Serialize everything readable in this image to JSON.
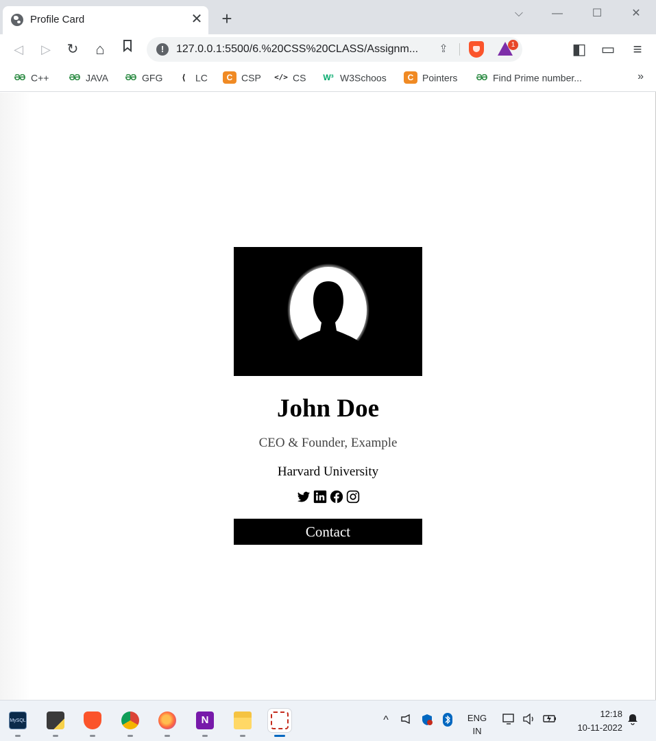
{
  "browser": {
    "tab": {
      "title": "Profile Card",
      "close_glyph": "✕"
    },
    "new_tab_glyph": "+",
    "window_controls": {
      "tabsearch": "⌵",
      "minimize": "—",
      "maximize": "☐",
      "close": "✕"
    },
    "toolbar": {
      "back_icon": "◁",
      "forward_icon": "▷",
      "reload_icon": "↻",
      "home_icon": "⌂",
      "bookmark_icon": "🔖",
      "url": "127.0.0.1:5500/6.%20CSS%20CLASS/Assignm...",
      "info_icon": "!",
      "share_icon": "⇪",
      "rewards_badge": "1",
      "sidebar_icon": "◧",
      "wallet_icon": "▭",
      "menu_icon": "≡"
    },
    "bookmarks": [
      {
        "label": "C++",
        "icon": "gfg-icon",
        "glyph": "ƏƏ"
      },
      {
        "label": "JAVA",
        "icon": "gfg-icon",
        "glyph": "ƏƏ"
      },
      {
        "label": "GFG",
        "icon": "gfg-icon",
        "glyph": "ƏƏ"
      },
      {
        "label": "LC",
        "icon": "leetcode-icon",
        "glyph": "⟨"
      },
      {
        "label": "CSP",
        "icon": "codechef-icon",
        "glyph": "C"
      },
      {
        "label": "CS",
        "icon": "code-icon",
        "glyph": "</>"
      },
      {
        "label": "W3Schoos",
        "icon": "w3schools-icon",
        "glyph": "W³"
      },
      {
        "label": "Pointers",
        "icon": "codechef-icon",
        "glyph": "C"
      },
      {
        "label": "Find Prime number...",
        "icon": "gfg-icon",
        "glyph": "ƏƏ"
      }
    ],
    "bookmarks_more": "»"
  },
  "profile": {
    "name": "John Doe",
    "title": "CEO & Founder, Example",
    "school": "Harvard University",
    "socials": [
      "twitter-icon",
      "linkedin-icon",
      "facebook-icon",
      "instagram-icon"
    ],
    "contact_label": "Contact"
  },
  "taskbar": {
    "apps": [
      "mysql-icon",
      "sticky-notes-icon",
      "brave-icon",
      "chrome-icon",
      "firefox-icon",
      "onenote-icon",
      "file-explorer-icon",
      "snipping-tool-icon"
    ],
    "mysql_label": "MySQL",
    "onenote_letter": "N",
    "tray_chevron": "^",
    "language_top": "ENG",
    "language_bottom": "IN",
    "time": "12:18",
    "date": "10-11-2022"
  },
  "colors": {
    "chrome_titlebar": "#dee1e6",
    "brave_orange": "#fb542b",
    "button_black": "#000000",
    "taskbar_accent": "#0067c0"
  }
}
